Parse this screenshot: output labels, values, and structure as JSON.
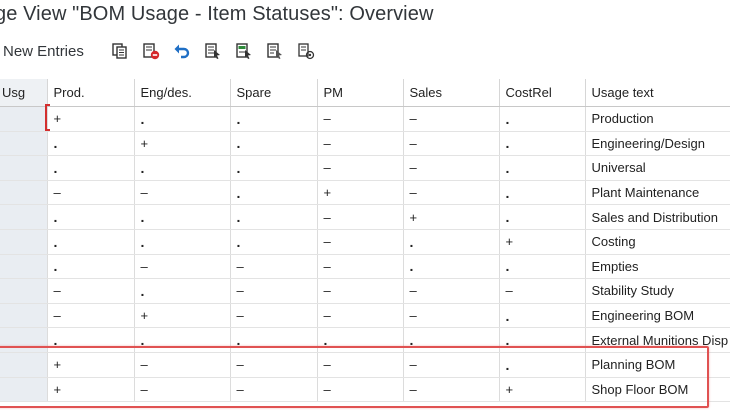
{
  "title": "ge View \"BOM Usage - Item Statuses\": Overview",
  "toolbar": {
    "new_entries_label": "New Entries",
    "icons": [
      "copy-icon",
      "delete-icon",
      "undo-icon",
      "select-all-icon",
      "select-block-icon",
      "deselect-all-icon",
      "print-icon"
    ]
  },
  "columns": [
    "Usg",
    "Prod.",
    "Eng/des.",
    "Spare",
    "PM",
    "Sales",
    "CostRel",
    "Usage text"
  ],
  "rows": [
    {
      "usg": "",
      "prod": "+",
      "eng": ".",
      "spare": ".",
      "pm": "–",
      "sales": "–",
      "costrel": ".",
      "text": "Production"
    },
    {
      "usg": "",
      "prod": ".",
      "eng": "+",
      "spare": ".",
      "pm": "–",
      "sales": "–",
      "costrel": ".",
      "text": "Engineering/Design"
    },
    {
      "usg": "",
      "prod": ".",
      "eng": ".",
      "spare": ".",
      "pm": "–",
      "sales": "–",
      "costrel": ".",
      "text": "Universal"
    },
    {
      "usg": "",
      "prod": "–",
      "eng": "–",
      "spare": ".",
      "pm": "+",
      "sales": "–",
      "costrel": ".",
      "text": "Plant Maintenance"
    },
    {
      "usg": "",
      "prod": ".",
      "eng": ".",
      "spare": ".",
      "pm": "–",
      "sales": "+",
      "costrel": ".",
      "text": "Sales and Distribution"
    },
    {
      "usg": "",
      "prod": ".",
      "eng": ".",
      "spare": ".",
      "pm": "–",
      "sales": ".",
      "costrel": "+",
      "text": "Costing"
    },
    {
      "usg": "",
      "prod": ".",
      "eng": "–",
      "spare": "–",
      "pm": "–",
      "sales": ".",
      "costrel": ".",
      "text": "Empties"
    },
    {
      "usg": "",
      "prod": "–",
      "eng": ".",
      "spare": "–",
      "pm": "–",
      "sales": "–",
      "costrel": "–",
      "text": "Stability Study"
    },
    {
      "usg": "",
      "prod": "–",
      "eng": "+",
      "spare": "–",
      "pm": "–",
      "sales": "–",
      "costrel": ".",
      "text": "Engineering BOM"
    },
    {
      "usg": "",
      "prod": ".",
      "eng": ".",
      "spare": ".",
      "pm": ".",
      "sales": ".",
      "costrel": ".",
      "text": "External Munitions Disp"
    },
    {
      "usg": "",
      "prod": "+",
      "eng": "–",
      "spare": "–",
      "pm": "–",
      "sales": "–",
      "costrel": ".",
      "text": "Planning BOM"
    },
    {
      "usg": "",
      "prod": "+",
      "eng": "–",
      "spare": "–",
      "pm": "–",
      "sales": "–",
      "costrel": "+",
      "text": "Shop Floor BOM"
    }
  ],
  "colors": {
    "highlight": "#e05252",
    "selection_column": "#e9edf2",
    "undo_icon": "#1f6fc5",
    "delete_icon": "#d6282b"
  }
}
